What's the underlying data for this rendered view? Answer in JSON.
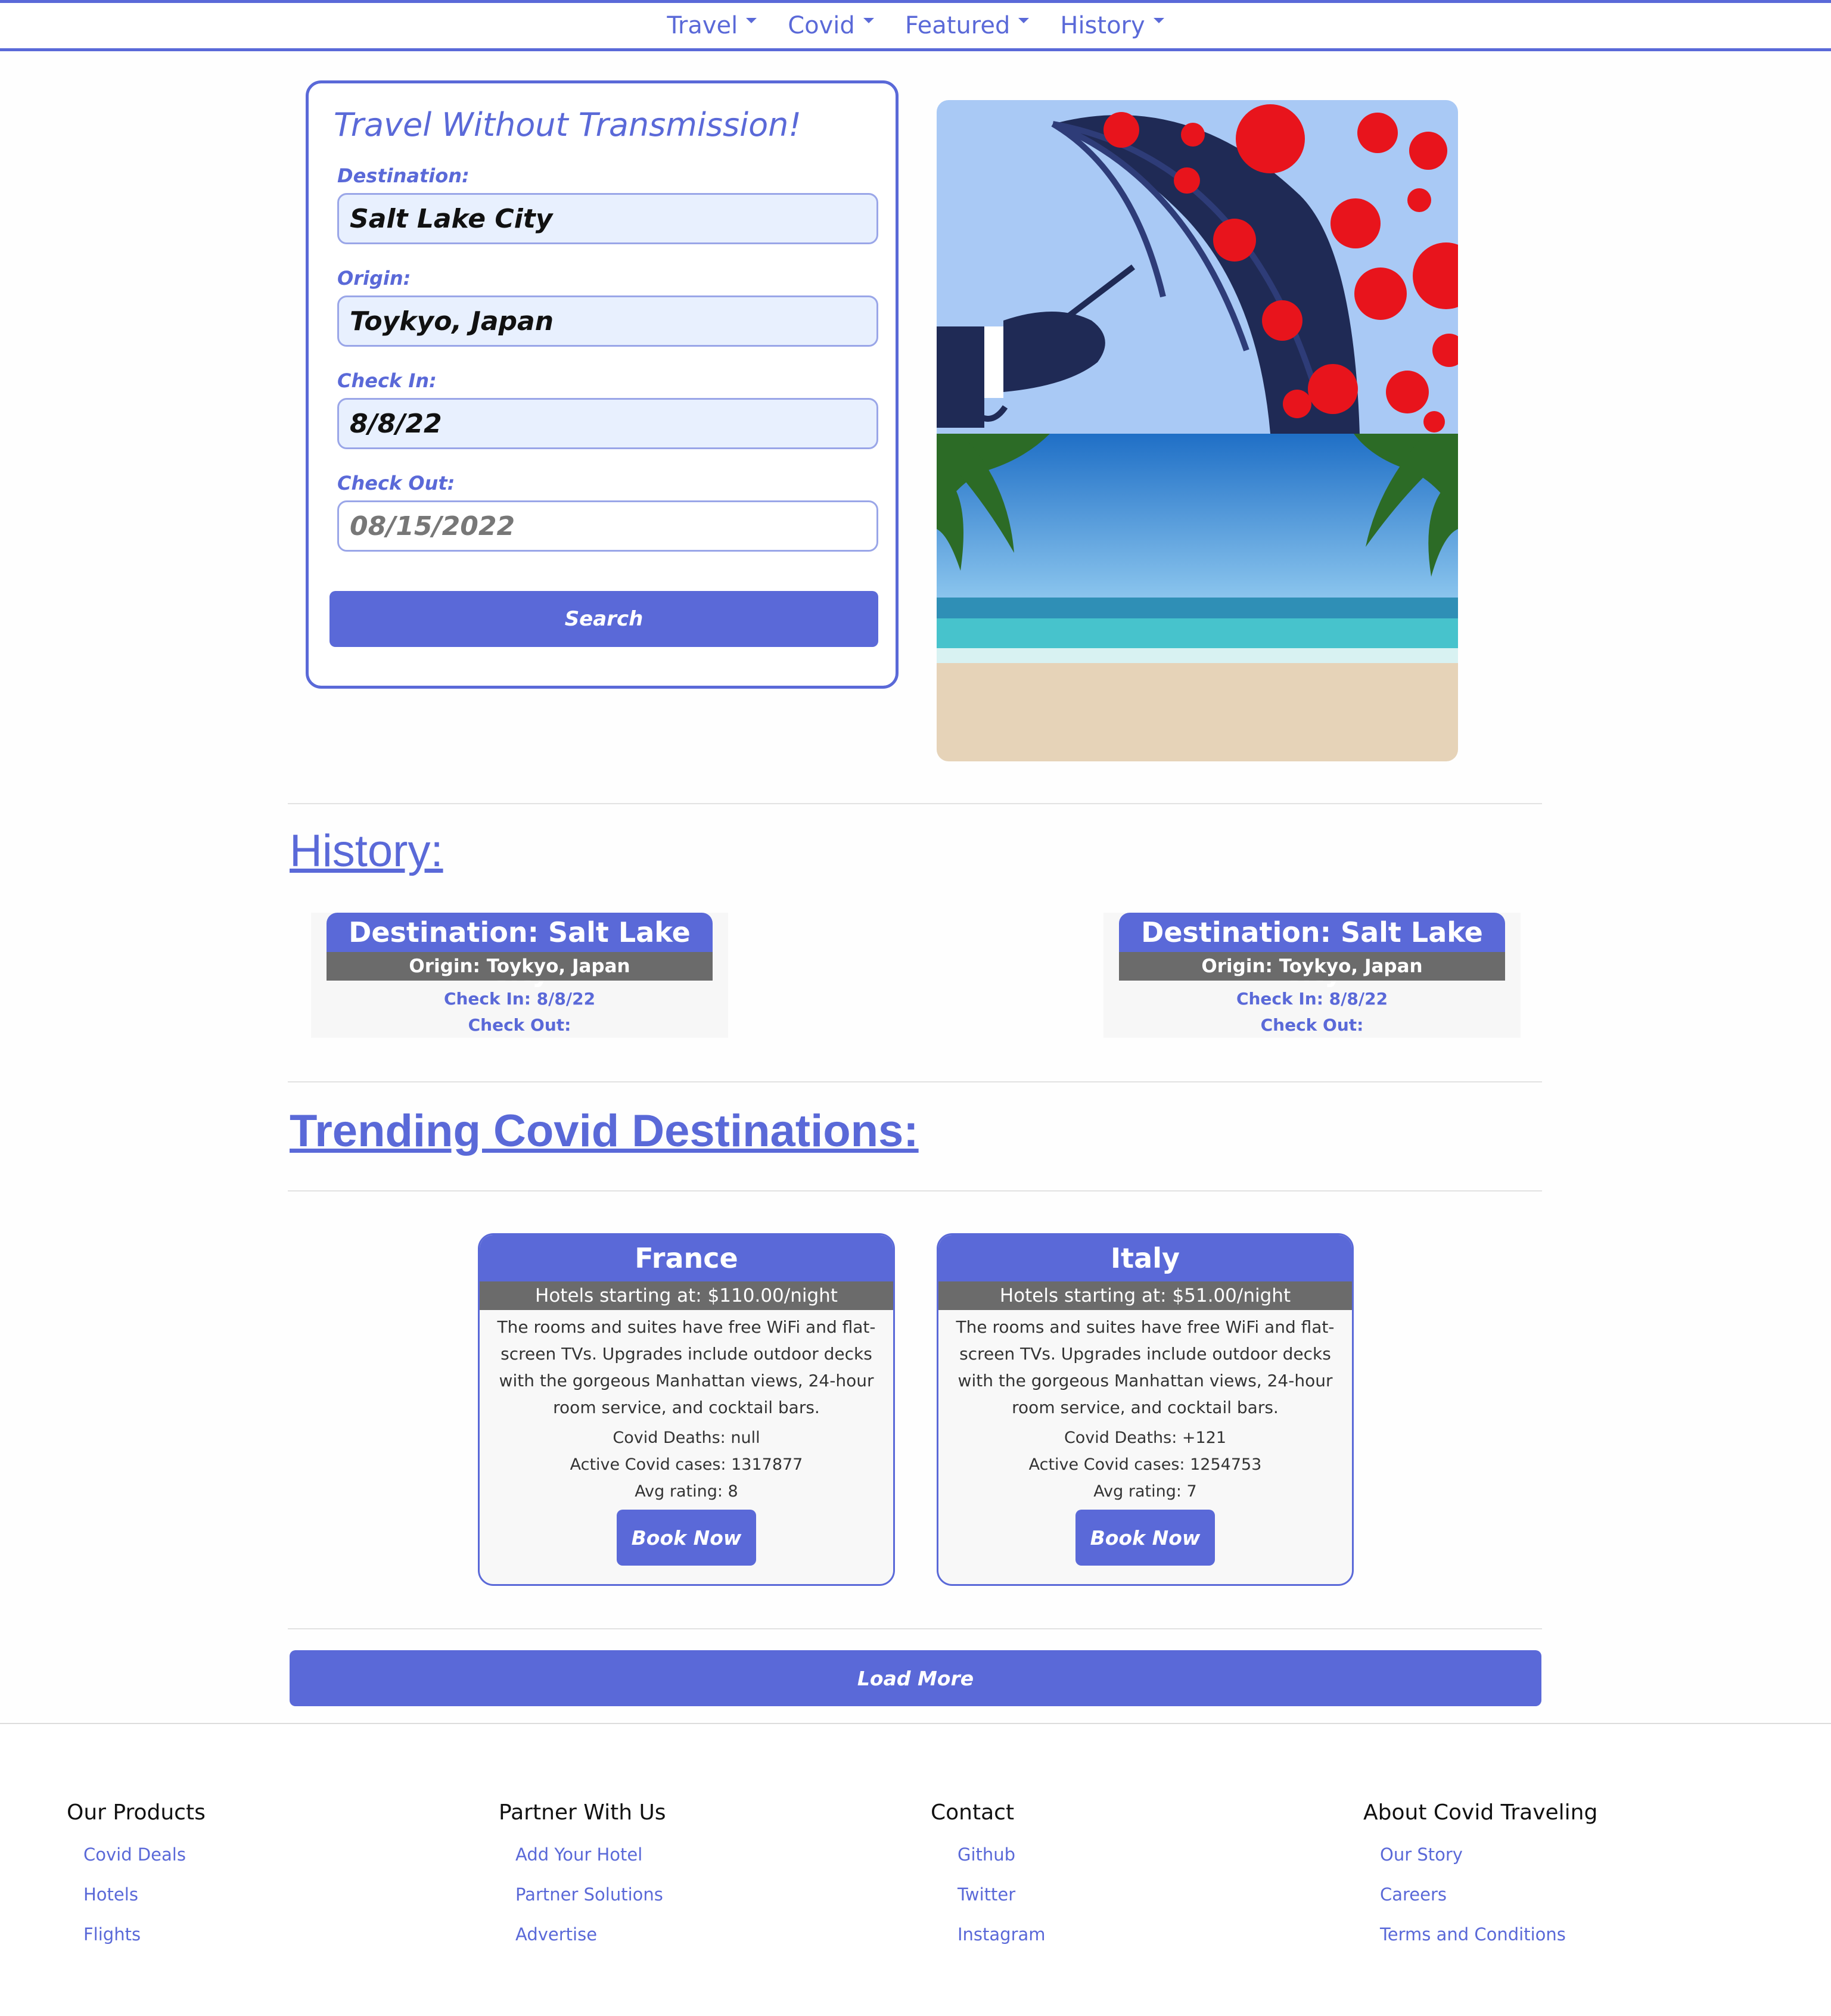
{
  "nav": {
    "items": [
      "Travel",
      "Covid",
      "Featured",
      "History"
    ]
  },
  "search": {
    "title": "Travel Without Transmission!",
    "destination_label": "Destination:",
    "destination_value": "Salt Lake City",
    "origin_label": "Origin:",
    "origin_value": "Toykyo, Japan",
    "checkin_label": "Check In:",
    "checkin_value": "8/8/22",
    "checkout_label": "Check Out:",
    "checkout_value": "08/15/2022",
    "button_label": "Search"
  },
  "history": {
    "heading": "History:",
    "entries": [
      {
        "destination": "Destination: Salt Lake City",
        "origin": "Origin: Toykyo, Japan",
        "checkin": "Check In: 8/8/22",
        "checkout": "Check Out:"
      },
      {
        "destination": "Destination: Salt Lake City",
        "origin": "Origin: Toykyo, Japan",
        "checkin": "Check In: 8/8/22",
        "checkout": "Check Out:"
      }
    ]
  },
  "trending": {
    "heading": "Trending Covid Destinations:",
    "destinations": [
      {
        "name": "France",
        "price": "Hotels starting at: $110.00/night",
        "description": "The rooms and suites have free WiFi and flat-screen TVs. Upgrades include outdoor decks with the gorgeous Manhattan views, 24-hour room service, and cocktail bars.",
        "deaths": "Covid Deaths: null",
        "cases": "Active Covid cases: 1317877",
        "rating": "Avg rating: 8",
        "button": "Book Now"
      },
      {
        "name": "Italy",
        "price": "Hotels starting at: $51.00/night",
        "description": "The rooms and suites have free WiFi and flat-screen TVs. Upgrades include outdoor decks with the gorgeous Manhattan views, 24-hour room service, and cocktail bars.",
        "deaths": "Covid Deaths: +121",
        "cases": "Active Covid cases: 1254753",
        "rating": "Avg rating: 7",
        "button": "Book Now"
      }
    ],
    "load_more": "Load More"
  },
  "footer": {
    "columns": [
      {
        "heading": "Our Products",
        "links": [
          "Covid Deals",
          "Hotels",
          "Flights"
        ]
      },
      {
        "heading": "Partner With Us",
        "links": [
          "Add Your Hotel",
          "Partner Solutions",
          "Advertise"
        ]
      },
      {
        "heading": "Contact",
        "links": [
          "Github",
          "Twitter",
          "Instagram"
        ]
      },
      {
        "heading": "About Covid Traveling",
        "links": [
          "Our Story",
          "Careers",
          "Terms and Conditions"
        ]
      }
    ]
  },
  "colors": {
    "accent": "#5a69d8",
    "grey_band": "#6b6b6b",
    "virus_red": "#e8141c",
    "umbrella_navy": "#1f2a55",
    "sky": "#a9c9f5"
  },
  "icons": [
    "dropdown-caret-icon",
    "virus-icon",
    "umbrella-image",
    "beach-palm-image"
  ]
}
